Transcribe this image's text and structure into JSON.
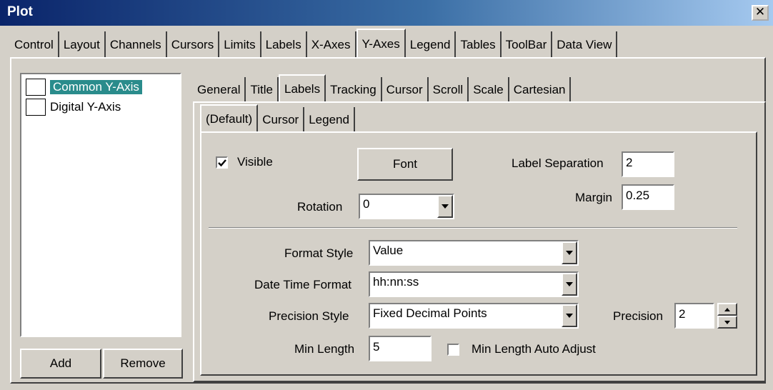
{
  "window": {
    "title": "Plot",
    "close_glyph": "✕"
  },
  "main_tabs": [
    "Control",
    "Layout",
    "Channels",
    "Cursors",
    "Limits",
    "Labels",
    "X-Axes",
    "Y-Axes",
    "Legend",
    "Tables",
    "ToolBar",
    "Data View"
  ],
  "main_tabs_active": "Y-Axes",
  "axis_list": {
    "items": [
      {
        "label": "Common Y-Axis",
        "selected": true
      },
      {
        "label": "Digital Y-Axis",
        "selected": false
      }
    ],
    "add_label": "Add",
    "remove_label": "Remove"
  },
  "sub_tabs": [
    "General",
    "Title",
    "Labels",
    "Tracking",
    "Cursor",
    "Scroll",
    "Scale",
    "Cartesian"
  ],
  "sub_tabs_active": "Labels",
  "inner_tabs": [
    "(Default)",
    "Cursor",
    "Legend"
  ],
  "inner_tabs_active": "(Default)",
  "form": {
    "visible_label": "Visible",
    "visible_checked": true,
    "font_button": "Font",
    "label_separation_label": "Label Separation",
    "label_separation_value": "2",
    "rotation_label": "Rotation",
    "rotation_value": "0",
    "margin_label": "Margin",
    "margin_value": "0.25",
    "format_style_label": "Format Style",
    "format_style_value": "Value",
    "date_time_format_label": "Date Time Format",
    "date_time_format_value": "hh:nn:ss",
    "precision_style_label": "Precision Style",
    "precision_style_value": "Fixed Decimal Points",
    "precision_label": "Precision",
    "precision_value": "2",
    "min_length_label": "Min Length",
    "min_length_value": "5",
    "min_length_auto_label": "Min Length Auto Adjust",
    "min_length_auto_checked": false
  },
  "colors": {
    "selection": "#2a8c8c",
    "dialog": "#d4d0c8",
    "titlebar": "#0a246a"
  },
  "icons": [
    "close-icon",
    "dropdown-arrow-icon",
    "checkmark-icon",
    "spin-up-icon",
    "spin-down-icon"
  ]
}
